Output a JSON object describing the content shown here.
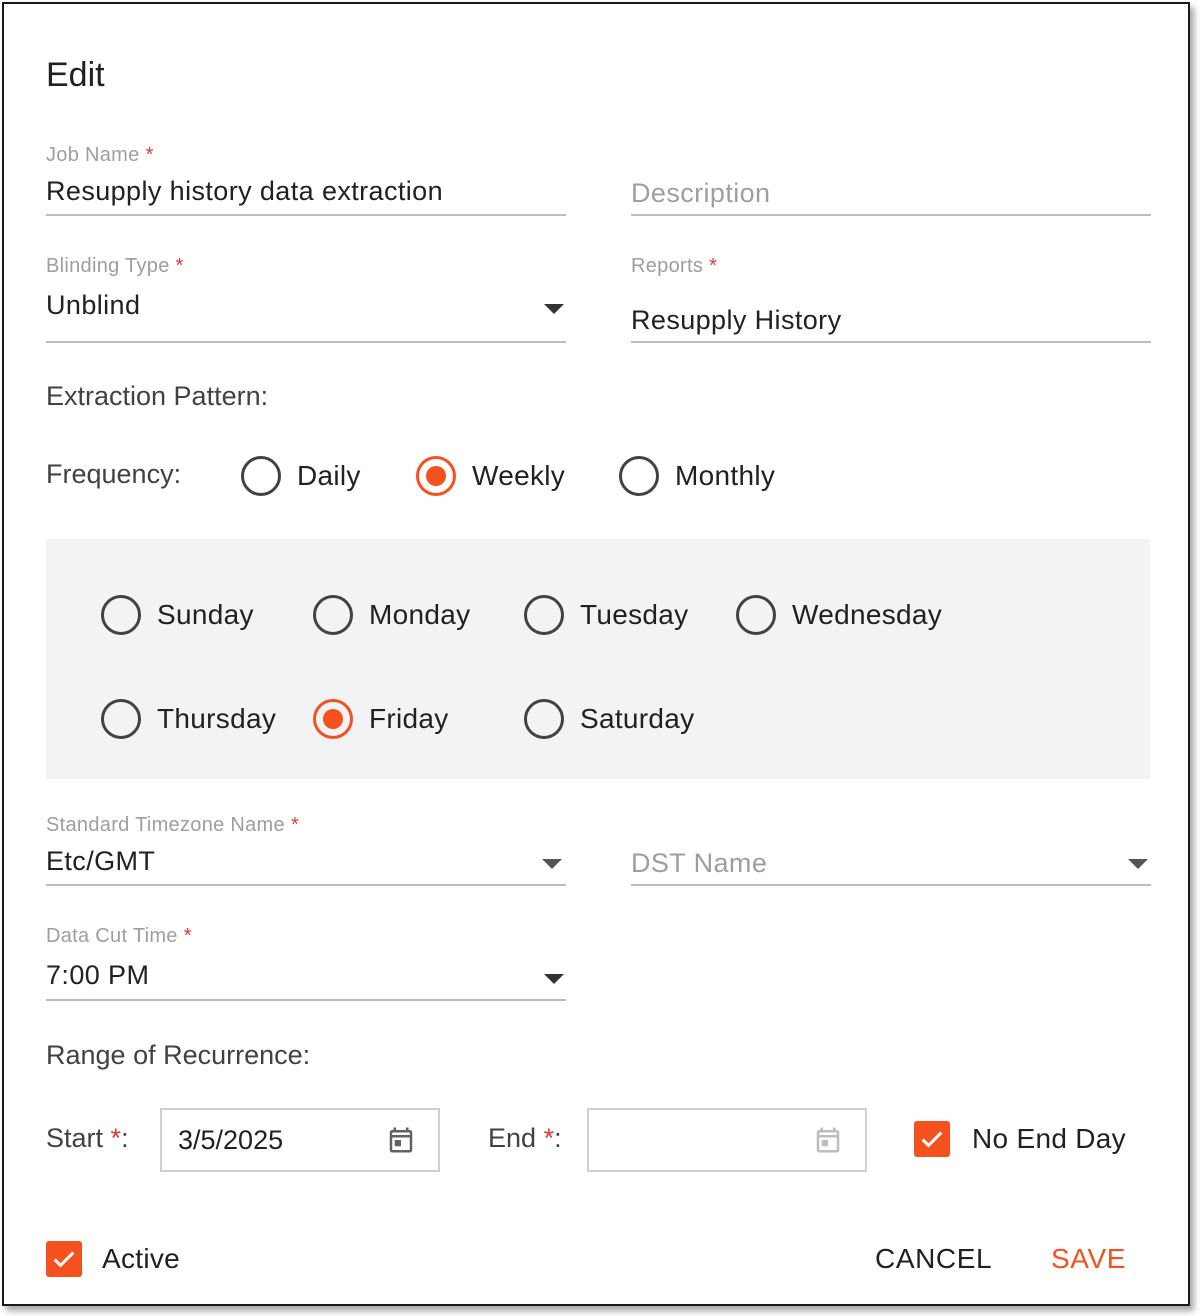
{
  "dialog": {
    "title": "Edit"
  },
  "job_name": {
    "label": "Job Name",
    "required_mark": "*",
    "value": "Resupply history data extraction"
  },
  "description": {
    "placeholder": "Description"
  },
  "blinding_type": {
    "label": "Blinding Type",
    "required_mark": "*",
    "value": "Unblind"
  },
  "reports": {
    "label": "Reports",
    "required_mark": "*",
    "value": "Resupply History"
  },
  "extraction_pattern": {
    "heading": "Extraction Pattern:"
  },
  "frequency": {
    "label": "Frequency:",
    "options": [
      {
        "label": "Daily",
        "checked": false
      },
      {
        "label": "Weekly",
        "checked": true
      },
      {
        "label": "Monthly",
        "checked": false
      }
    ]
  },
  "days": [
    {
      "label": "Sunday",
      "checked": false
    },
    {
      "label": "Monday",
      "checked": false
    },
    {
      "label": "Tuesday",
      "checked": false
    },
    {
      "label": "Wednesday",
      "checked": false
    },
    {
      "label": "Thursday",
      "checked": false
    },
    {
      "label": "Friday",
      "checked": true
    },
    {
      "label": "Saturday",
      "checked": false
    }
  ],
  "timezone": {
    "label": "Standard Timezone Name",
    "required_mark": "*",
    "value": "Etc/GMT"
  },
  "dst": {
    "placeholder": "DST Name"
  },
  "data_cut_time": {
    "label": "Data Cut Time",
    "required_mark": "*",
    "value": "7:00 PM"
  },
  "range_of_recurrence": {
    "heading": "Range of Recurrence:",
    "start_label": "Start",
    "start_required": "*",
    "start_colon": ":",
    "start_value": "3/5/2025",
    "end_label": "End",
    "end_required": "*",
    "end_colon": ":",
    "end_value": "",
    "no_end_day_label": "No End Day",
    "no_end_day_checked": true
  },
  "footer": {
    "active_label": "Active",
    "active_checked": true,
    "cancel_label": "CANCEL",
    "save_label": "SAVE"
  },
  "colors": {
    "accent": "#f4511e",
    "required": "#e53935",
    "panel_bg": "#f2f3f5"
  },
  "icons": {
    "dropdown": "caret-down-icon",
    "calendar": "calendar-icon",
    "check": "checkmark-icon"
  }
}
